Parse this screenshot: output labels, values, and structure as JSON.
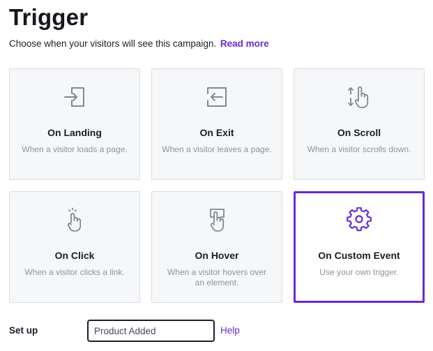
{
  "header": {
    "title": "Trigger",
    "subtitle": "Choose when your visitors will see this campaign.",
    "read_more": "Read more"
  },
  "colors": {
    "accent": "#6a2bd1",
    "icon": "#7f8a96",
    "card_bg": "#f5f7f9"
  },
  "triggers": [
    {
      "name": "On Landing",
      "description": "When a visitor loads a page.",
      "icon": "enter-icon",
      "selected": false
    },
    {
      "name": "On Exit",
      "description": "When a visitor leaves a page.",
      "icon": "exit-icon",
      "selected": false
    },
    {
      "name": "On Scroll",
      "description": "When a visitor scrolls down.",
      "icon": "scroll-hand-icon",
      "selected": false
    },
    {
      "name": "On Click",
      "description": "When a visitor clicks a link.",
      "icon": "click-hand-icon",
      "selected": false
    },
    {
      "name": "On Hover",
      "description": "When a visitor hovers over an element.",
      "icon": "hover-hand-icon",
      "selected": false
    },
    {
      "name": "On Custom Event",
      "description": "Use your own trigger.",
      "icon": "gear-icon",
      "selected": true
    }
  ],
  "setup": {
    "label": "Set up",
    "value": "Product Added",
    "help": "Help"
  }
}
